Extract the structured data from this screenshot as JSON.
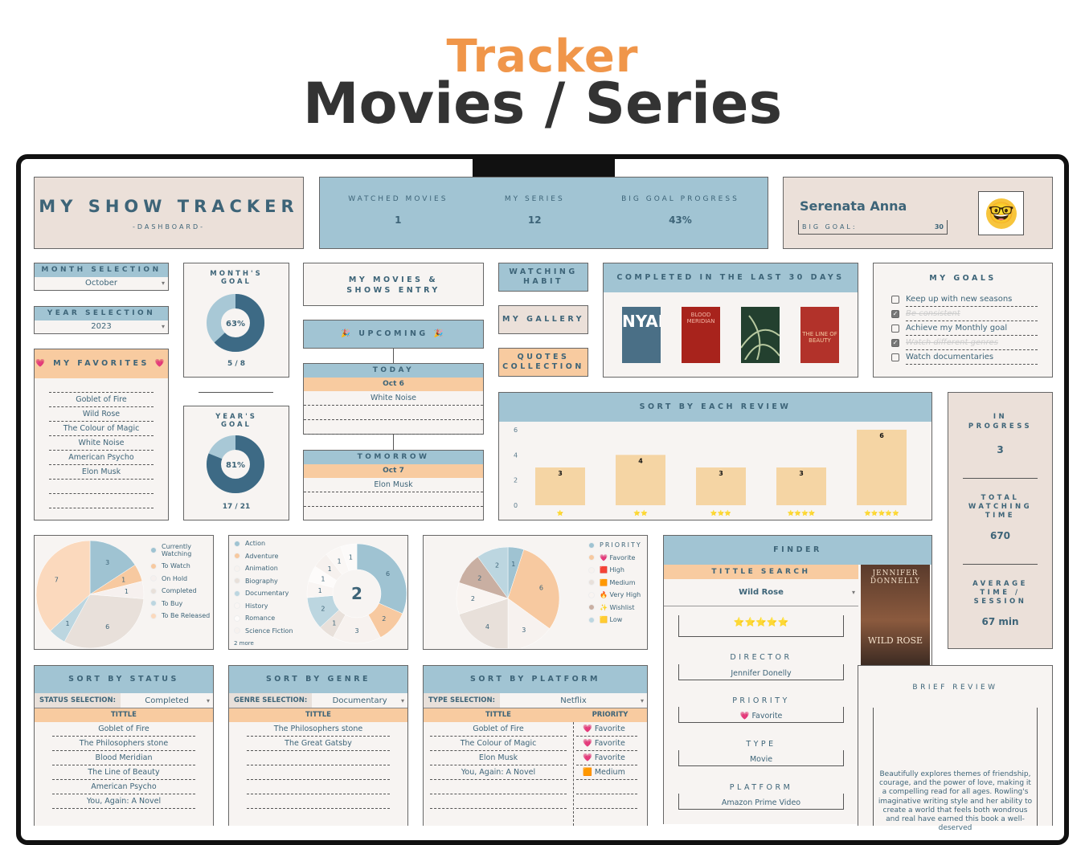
{
  "header": {
    "subtitle": "Tracker",
    "title": "Movies / Series"
  },
  "dashboard": {
    "title": "MY SHOW TRACKER",
    "subtitle": "-DASHBOARD-"
  },
  "stats": [
    {
      "label": "WATCHED MOVIES",
      "value": "1"
    },
    {
      "label": "MY SERIES",
      "value": "12"
    },
    {
      "label": "BIG GOAL PROGRESS",
      "value": "43%"
    }
  ],
  "profile": {
    "name": "Serenata Anna",
    "big_goal_label": "BIG GOAL:",
    "big_goal_value": "30",
    "avatar_icon": "nerd-face-emoji"
  },
  "month_selection": {
    "label": "MONTH SELECTION",
    "value": "October"
  },
  "year_selection": {
    "label": "YEAR SELECTION",
    "value": "2023"
  },
  "favorites": {
    "title": "MY FAVORITES",
    "icon": "heart-icon",
    "items": [
      "",
      "Goblet of Fire",
      "Wild Rose",
      "The Colour of Magic",
      "White Noise",
      "American Psycho",
      "Elon Musk",
      "",
      ""
    ]
  },
  "month_goal": {
    "title": "MONTH'S GOAL",
    "percent": 63,
    "percent_label": "63%",
    "progress": "5 / 8"
  },
  "year_goal": {
    "title": "YEAR'S GOAL",
    "percent": 81,
    "percent_label": "81%",
    "progress": "17 / 21"
  },
  "nav": {
    "entry": "MY MOVIES & SHOWS ENTRY",
    "upcoming": "UPCOMING",
    "watching_habit": "WATCHING HABIT",
    "gallery": "MY GALLERY",
    "quotes": "QUOTES COLLECTION"
  },
  "today": {
    "label": "TODAY",
    "date": "Oct 6",
    "items": [
      "White Noise",
      "",
      ""
    ]
  },
  "tomorrow": {
    "label": "TOMORROW",
    "date": "Oct 7",
    "items": [
      "Elon Musk",
      ""
    ]
  },
  "completed": {
    "title": "COMPLETED IN THE LAST 30 DAYS",
    "posters": [
      {
        "title": "NYAD",
        "color": "#4a6f86"
      },
      {
        "title": "BLOOD MERIDIAN",
        "color": "#a8231c"
      },
      {
        "title": "",
        "color": "#23402f"
      },
      {
        "title": "THE LINE OF BEAUTY",
        "color": "#b2322a"
      }
    ]
  },
  "goals": {
    "title": "MY GOALS",
    "items": [
      {
        "text": "Keep up with new seasons",
        "done": false
      },
      {
        "text": "Be consistent",
        "done": true
      },
      {
        "text": "Achieve my Monthly goal",
        "done": false
      },
      {
        "text": "Watch different genres",
        "done": true
      },
      {
        "text": "Watch documentaries",
        "done": false
      }
    ]
  },
  "summary": {
    "in_progress_label": "IN PROGRESS",
    "in_progress": "3",
    "total_time_label": "TOTAL WATCHING TIME",
    "total_time": "670",
    "avg_label": "AVERAGE TIME / SESSION",
    "avg": "67 min"
  },
  "review_title": "SORT BY EACH REVIEW",
  "chart_data": [
    {
      "type": "bar",
      "title": "SORT BY EACH REVIEW",
      "categories": [
        "⭐",
        "⭐⭐",
        "⭐⭐⭐",
        "⭐⭐⭐⭐",
        "⭐⭐⭐⭐⭐"
      ],
      "values": [
        3,
        4,
        3,
        3,
        6
      ],
      "ylim": [
        0,
        6
      ],
      "yticks": [
        0,
        2,
        4,
        6
      ],
      "bar_color": "#f5d5a4",
      "grid": false
    },
    {
      "type": "pie",
      "categories": [
        "Currently Watching",
        "To Watch",
        "On Hold",
        "Completed",
        "To Buy",
        "To Be Released"
      ],
      "values": [
        3,
        1,
        1,
        6,
        1,
        7
      ],
      "colors": [
        "#9fc3d2",
        "#f7c9a0",
        "#f6f0ee",
        "#e8e0da",
        "#bcd6e0",
        "#fbd9bd"
      ],
      "legend": "right"
    },
    {
      "type": "donut",
      "categories": [
        "Action",
        "Adventure",
        "Animation",
        "Biography",
        "Documentary",
        "History",
        "Romance",
        "Science Fiction"
      ],
      "values": [
        6,
        2,
        3,
        1,
        2,
        1,
        1,
        1
      ],
      "hidden_values": [
        1,
        1
      ],
      "more_label": "2 more",
      "center_label": "2",
      "colors": [
        "#9fc3d2",
        "#f7c9a0",
        "#f7f2ef",
        "#e8e0da",
        "#bcd6e0",
        "#f9f5f3",
        "#fdfbfa",
        "#f6f1ee",
        "#faf7f5",
        "#fcfaf9"
      ],
      "legend": "left"
    },
    {
      "type": "pie",
      "series_name": "PRIORITY",
      "categories": [
        "PRIORITY",
        "💗 Favorite",
        "🟥 High",
        "🟧 Medium",
        "🔥 Very High",
        "✨ Wishlist",
        "🟨 Low"
      ],
      "values": [
        1,
        6,
        3,
        4,
        2,
        2,
        2
      ],
      "colors": [
        "#9fc3d2",
        "#f7c9a0",
        "#f7f2ef",
        "#e8e0da",
        "#f9f4f1",
        "#c9afa2",
        "#bcd6e0"
      ],
      "legend": "right"
    }
  ],
  "finder": {
    "title": "FINDER",
    "search_label": "TITTLE SEARCH",
    "search_value": "Wild Rose",
    "rating": "⭐⭐⭐⭐⭐",
    "director_label": "DIRECTOR",
    "director": "Jennifer Donelly",
    "priority_label": "PRIORITY",
    "priority": "💗 Favorite",
    "type_label": "TYPE",
    "type": "Movie",
    "platform_label": "PLATFORM",
    "platform": "Amazon Prime Video",
    "poster_author": "JENNIFER DONNELLY",
    "poster_title": "WILD ROSE"
  },
  "brief_review": {
    "title": "BRIEF REVIEW",
    "text": "Beautifully explores themes of friendship, courage, and the power of love, making it a compelling read for all ages. Rowling's imaginative writing style and her ability to create a world that feels both wondrous and real have earned this book a well-deserved"
  },
  "status_table": {
    "title": "SORT BY STATUS",
    "filter_label": "STATUS SELECTION:",
    "filter_value": "Completed",
    "col": "TITTLE",
    "rows": [
      "Goblet of Fire",
      "The Philosophers stone",
      "Blood Meridian",
      "The Line of Beauty",
      "American Psycho",
      "You, Again: A Novel"
    ]
  },
  "genre_table": {
    "title": "SORT BY GENRE",
    "filter_label": "GENRE SELECTION:",
    "filter_value": "Documentary",
    "col": "TITTLE",
    "rows": [
      "The Philosophers stone",
      "The Great Gatsby",
      "",
      "",
      "",
      ""
    ]
  },
  "platform_table": {
    "title": "SORT BY PLATFORM",
    "filter_label": "TYPE SELECTION:",
    "filter_value": "Netflix",
    "col": "TITTLE",
    "col2": "PRIORITY",
    "rows": [
      {
        "title": "Goblet of Fire",
        "priority": "💗 Favorite"
      },
      {
        "title": "The Colour of Magic",
        "priority": "💗 Favorite"
      },
      {
        "title": "Elon Musk",
        "priority": "💗 Favorite"
      },
      {
        "title": "You, Again: A Novel",
        "priority": "🟧 Medium"
      },
      {
        "title": "",
        "priority": ""
      },
      {
        "title": "",
        "priority": ""
      }
    ]
  }
}
